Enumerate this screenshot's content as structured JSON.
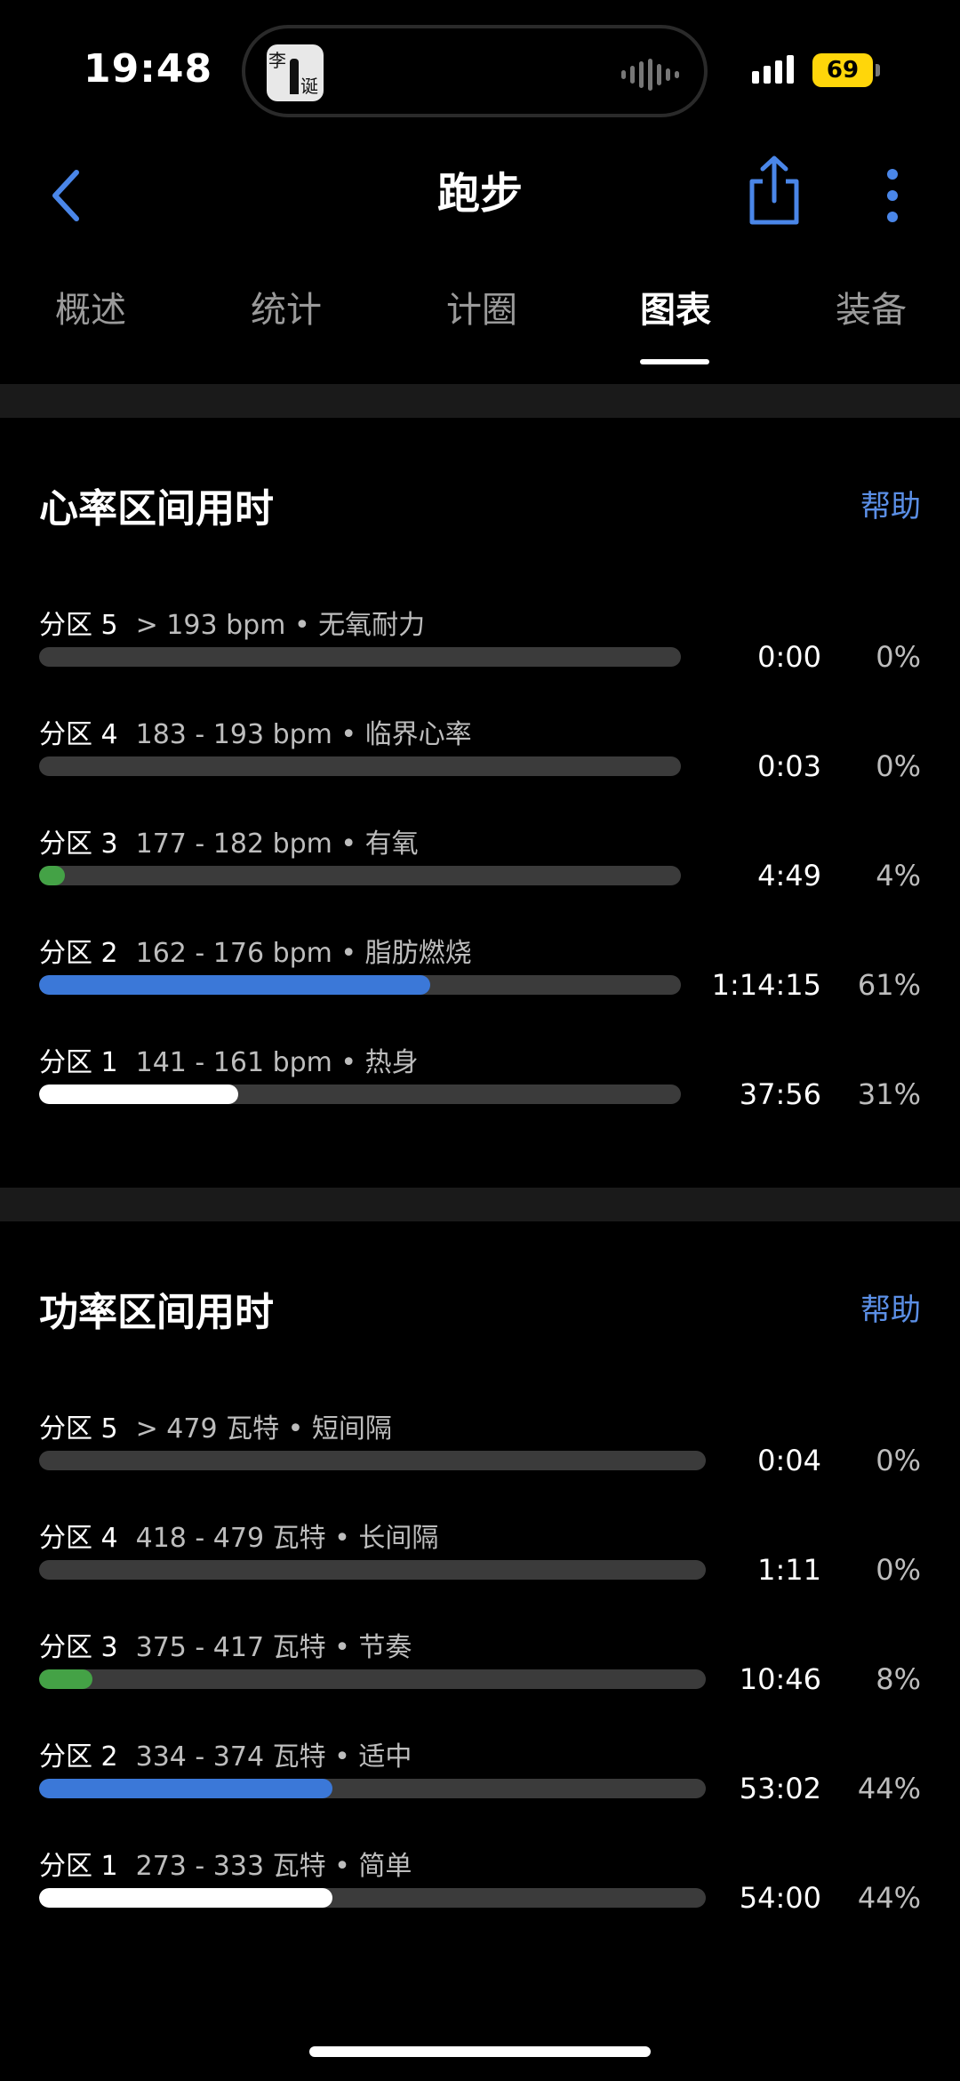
{
  "status": {
    "time": "19:48",
    "battery": "69",
    "island_chars": [
      "李",
      "诞"
    ]
  },
  "nav": {
    "title": "跑步"
  },
  "tabs": [
    "概述",
    "统计",
    "计圈",
    "图表",
    "装备"
  ],
  "active_tab": 3,
  "hr_section": {
    "title": "心率区间用时",
    "help": "帮助",
    "zones": [
      {
        "zone": "分区 5",
        "range": "> 193 bpm • 无氧耐力",
        "time": "0:00",
        "pct": "0%",
        "fill_pct": 0,
        "color": "#3b3b3b"
      },
      {
        "zone": "分区 4",
        "range": "183 - 193 bpm • 临界心率",
        "time": "0:03",
        "pct": "0%",
        "fill_pct": 0,
        "color": "#3b3b3b"
      },
      {
        "zone": "分区 3",
        "range": "177 - 182 bpm • 有氧",
        "time": "4:49",
        "pct": "4%",
        "fill_pct": 4,
        "color": "#44a246"
      },
      {
        "zone": "分区 2",
        "range": "162 - 176 bpm • 脂肪燃烧",
        "time": "1:14:15",
        "pct": "61%",
        "fill_pct": 61,
        "color": "#3b78d8"
      },
      {
        "zone": "分区 1",
        "range": "141 - 161 bpm • 热身",
        "time": "37:56",
        "pct": "31%",
        "fill_pct": 31,
        "color": "#ffffff"
      }
    ]
  },
  "power_section": {
    "title": "功率区间用时",
    "help": "帮助",
    "zones": [
      {
        "zone": "分区 5",
        "range": "> 479 瓦特 • 短间隔",
        "time": "0:04",
        "pct": "0%",
        "fill_pct": 0,
        "color": "#3b3b3b"
      },
      {
        "zone": "分区 4",
        "range": "418 - 479 瓦特 • 长间隔",
        "time": "1:11",
        "pct": "0%",
        "fill_pct": 0,
        "color": "#3b3b3b"
      },
      {
        "zone": "分区 3",
        "range": "375 - 417 瓦特 • 节奏",
        "time": "10:46",
        "pct": "8%",
        "fill_pct": 8,
        "color": "#44a246"
      },
      {
        "zone": "分区 2",
        "range": "334 - 374 瓦特 • 适中",
        "time": "53:02",
        "pct": "44%",
        "fill_pct": 44,
        "color": "#3b78d8"
      },
      {
        "zone": "分区 1",
        "range": "273 - 333 瓦特 • 简单",
        "time": "54:00",
        "pct": "44%",
        "fill_pct": 44,
        "color": "#ffffff"
      }
    ]
  }
}
